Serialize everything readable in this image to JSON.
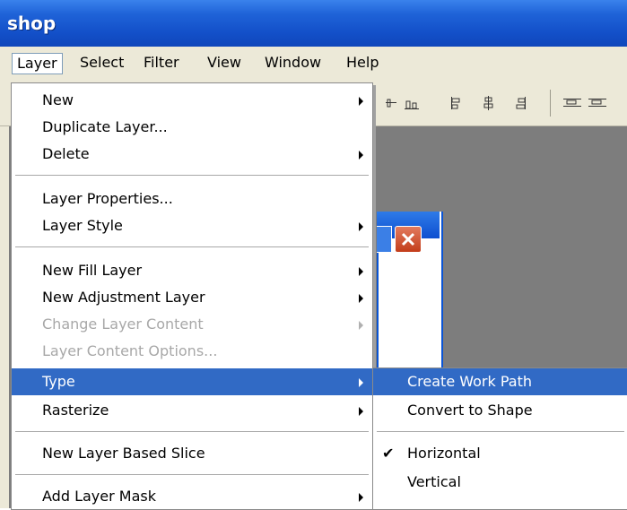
{
  "window": {
    "title": "shop"
  },
  "menubar": [
    "Layer",
    "Select",
    "Filter",
    "View",
    "Window",
    "Help"
  ],
  "layer_menu": {
    "items": [
      {
        "label": "New",
        "submenu": true
      },
      {
        "label": "Duplicate Layer..."
      },
      {
        "label": "Delete",
        "submenu": true
      },
      {
        "label": "Layer Properties..."
      },
      {
        "label": "Layer Style",
        "submenu": true
      },
      {
        "label": "New Fill Layer",
        "submenu": true
      },
      {
        "label": "New Adjustment Layer",
        "submenu": true
      },
      {
        "label": "Change Layer Content",
        "submenu": true,
        "disabled": true
      },
      {
        "label": "Layer Content Options...",
        "disabled": true
      },
      {
        "label": "Type",
        "submenu": true,
        "highlighted": true
      },
      {
        "label": "Rasterize",
        "submenu": true
      },
      {
        "label": "New Layer Based Slice"
      },
      {
        "label": "Add Layer Mask",
        "submenu": true
      }
    ]
  },
  "type_submenu": {
    "items": [
      {
        "label": "Create Work Path",
        "highlighted": true
      },
      {
        "label": "Convert to Shape"
      },
      {
        "label": "Horizontal",
        "checked": true,
        "check_glyph": "✔"
      },
      {
        "label": "Vertical"
      }
    ]
  },
  "colors": {
    "title_bar": "#1350c9",
    "highlight": "#316ac5",
    "menu_bg": "#ece9d8",
    "workspace": "#7d7d7d"
  }
}
